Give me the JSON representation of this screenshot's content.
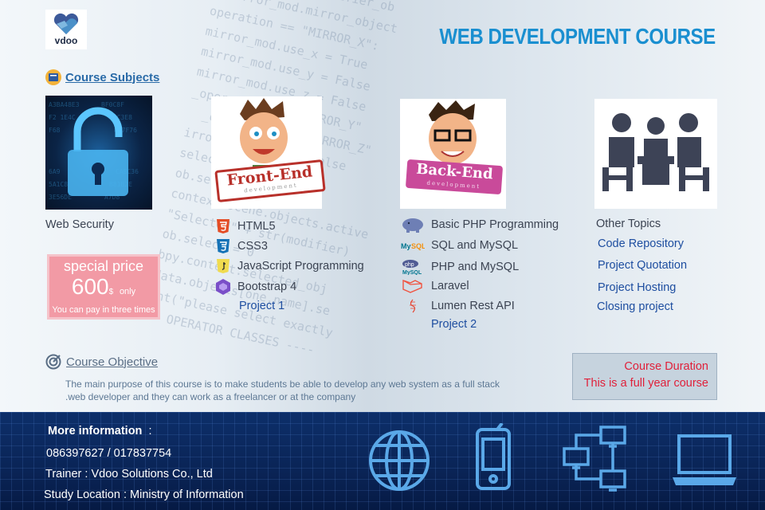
{
  "brand": {
    "name": "vdoo"
  },
  "title": "WEB DEVELOPMENT COURSE",
  "course_subjects": {
    "heading_prefix": "Course",
    "heading_rest": " Subjects"
  },
  "security": {
    "label": "Web Security"
  },
  "front_end": {
    "banner": "Front-End",
    "banner_sub": "development",
    "items": [
      {
        "icon": "html5-icon",
        "label": "HTML5"
      },
      {
        "icon": "css3-icon",
        "label": "CSS3"
      },
      {
        "icon": "javascript-icon",
        "label": "JavaScript Programming"
      },
      {
        "icon": "bootstrap-icon",
        "label": "Bootstrap 4"
      }
    ],
    "project": "Project 1"
  },
  "back_end": {
    "banner": "Back-End",
    "banner_sub": "development",
    "items": [
      {
        "icon": "php-elephant-icon",
        "label": "Basic PHP Programming"
      },
      {
        "icon": "mysql-icon",
        "label": "SQL and MySQL"
      },
      {
        "icon": "php-mysql-icon",
        "label": "PHP and MySQL"
      },
      {
        "icon": "laravel-icon",
        "label": "Laravel"
      },
      {
        "icon": "lumen-icon",
        "label": "Lumen Rest API"
      }
    ],
    "project": "Project 2"
  },
  "other": {
    "label": "Other Topics",
    "items": [
      "Code Repository",
      "Project Quotation",
      "Project Hosting",
      "Closing project"
    ]
  },
  "price": {
    "title": "special price",
    "amount": "600",
    "currency": "$",
    "only": "only",
    "note": "You can pay in three times"
  },
  "objective": {
    "heading": "Course Objective",
    "line1": "The main purpose of this course is to make students be able to develop any web system as a full stack",
    "line2": ".web developer and they can work as a freelancer or at the company"
  },
  "duration": {
    "title": "Course Duration",
    "text": "This is a full year course"
  },
  "contact": {
    "more_info": "More information",
    "colon": ":",
    "phones": "086397627  /  017837754",
    "trainer": "Trainer :  Vdoo Solutions Co., Ltd",
    "location": "Study Location : Ministry of Information"
  },
  "colors": {
    "title": "#1a8fd0",
    "accent_blue": "#1e4ea0",
    "price_bg": "#f29aa5",
    "duration_text": "#e0203a",
    "footer_bg": "#0a2456"
  }
}
